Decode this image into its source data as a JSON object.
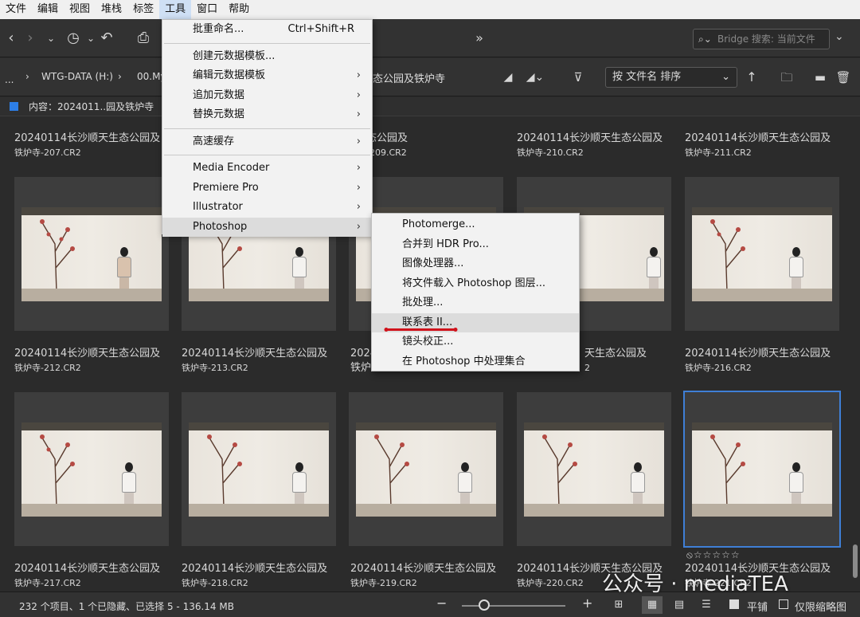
{
  "menubar": {
    "items": [
      "文件",
      "编辑",
      "视图",
      "堆栈",
      "标签",
      "工具",
      "窗口",
      "帮助"
    ]
  },
  "toolbar": {
    "search_placeholder": "Bridge 搜索: 当前文件",
    "more_label": "»"
  },
  "path": {
    "ellipsis": "...",
    "drive": "WTG-DATA (H:)",
    "folder1": "00.My",
    "folder_tail": "态公园及铁炉寺",
    "sort_label": "按 文件名 排序"
  },
  "content_header": "内容：2024011..园及铁炉寺",
  "tools_menu": {
    "items": [
      {
        "label": "批重命名...",
        "shortcut": "Ctrl+Shift+R"
      },
      {
        "label": "创建元数据模板..."
      },
      {
        "label": "编辑元数据模板",
        "submenu": true
      },
      {
        "label": "追加元数据",
        "submenu": true
      },
      {
        "label": "替换元数据",
        "submenu": true
      },
      {
        "label": "高速缓存",
        "submenu": true
      },
      {
        "label": "Media Encoder",
        "submenu": true
      },
      {
        "label": "Premiere Pro",
        "submenu": true
      },
      {
        "label": "Illustrator",
        "submenu": true
      },
      {
        "label": "Photoshop",
        "submenu": true
      }
    ]
  },
  "photoshop_menu": {
    "items": [
      "Photomerge...",
      "合并到 HDR Pro...",
      "图像处理器...",
      "将文件载入 Photoshop 图层...",
      "批处理...",
      "联系表 II...",
      "镜头校正...",
      "在 Photoshop 中处理集合"
    ],
    "highlighted_index": 5
  },
  "grid": {
    "row1_titles": [
      {
        "line1": "20240114长沙顺天生态公园及",
        "line2": "铁炉寺-207.CR2"
      },
      {
        "line1": "",
        "line2": ""
      },
      {
        "line1": "态公园及",
        "line2": "-209.CR2"
      },
      {
        "line1": "20240114长沙顺天生态公园及",
        "line2": "铁炉寺-210.CR2"
      },
      {
        "line1": "20240114长沙顺天生态公园及",
        "line2": "铁炉寺-211.CR2"
      }
    ],
    "row2_titles": [
      {
        "line1": "20240114长沙顺天生态公园及",
        "line2": "铁炉寺-212.CR2"
      },
      {
        "line1": "20240114长沙顺天生态公园及",
        "line2": "铁炉寺-213.CR2"
      },
      {
        "line1": "2024",
        "line2": "铁炉"
      },
      {
        "line1": "天生态公园及",
        "line2": "2"
      },
      {
        "line1": "20240114长沙顺天生态公园及",
        "line2": "铁炉寺-216.CR2"
      }
    ],
    "row3_titles": [
      {
        "line1": "20240114长沙顺天生态公园及",
        "line2": "铁炉寺-217.CR2"
      },
      {
        "line1": "20240114长沙顺天生态公园及",
        "line2": "铁炉寺-218.CR2"
      },
      {
        "line1": "20240114长沙顺天生态公园及",
        "line2": "铁炉寺-219.CR2"
      },
      {
        "line1": "20240114长沙顺天生态公园及",
        "line2": "铁炉寺-220.CR2"
      },
      {
        "line1": "20240114长沙顺天生态公园及",
        "line2": "铁炉寺-221.CR2"
      }
    ],
    "rating_stars": "⦸☆☆☆☆☆"
  },
  "status": {
    "summary": "232 个项目、1 个已隐藏、已选择 5 - 136.14 MB",
    "zoom_out": "−",
    "zoom_in": "+",
    "tile_label": "平铺",
    "thumbs_only_label": "仅限缩略图"
  },
  "watermark": "公众号 · mediaTEA",
  "colors": {
    "selection": "#3f7fd6",
    "accent": "#2d7ee6",
    "underline": "#d0121b"
  }
}
